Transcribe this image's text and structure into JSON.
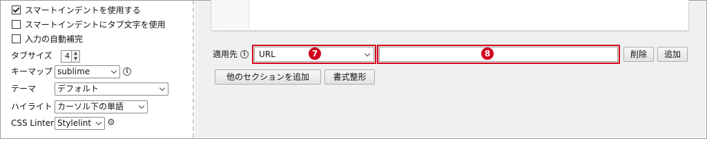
{
  "settings": {
    "smart_indent": {
      "label": "スマートインデントを使用する",
      "checked": true
    },
    "smart_indent_tabs": {
      "label": "スマートインデントにタブ文字を使用",
      "checked": false
    },
    "auto_complete": {
      "label": "入力の自動補完",
      "checked": false
    },
    "tab_size": {
      "label": "タブサイズ",
      "value": "4"
    },
    "keymap": {
      "label": "キーマップ",
      "value": "sublime"
    },
    "theme": {
      "label": "テーマ",
      "value": "デフォルト"
    },
    "highlight": {
      "label": "ハイライト",
      "value": "カーソル下の単語"
    },
    "linter": {
      "label": "CSS Linter",
      "value": "Stylelint"
    }
  },
  "apply": {
    "label": "適用先",
    "type_value": "URL",
    "value_input": "",
    "delete_label": "削除",
    "add_label": "追加",
    "type_badge": "7",
    "input_badge": "8"
  },
  "section": {
    "add_section_label": "他のセクションを追加",
    "format_label": "書式整形"
  },
  "colors": {
    "highlight": "#d0021b",
    "editor_bg": "#f0f0f0"
  }
}
